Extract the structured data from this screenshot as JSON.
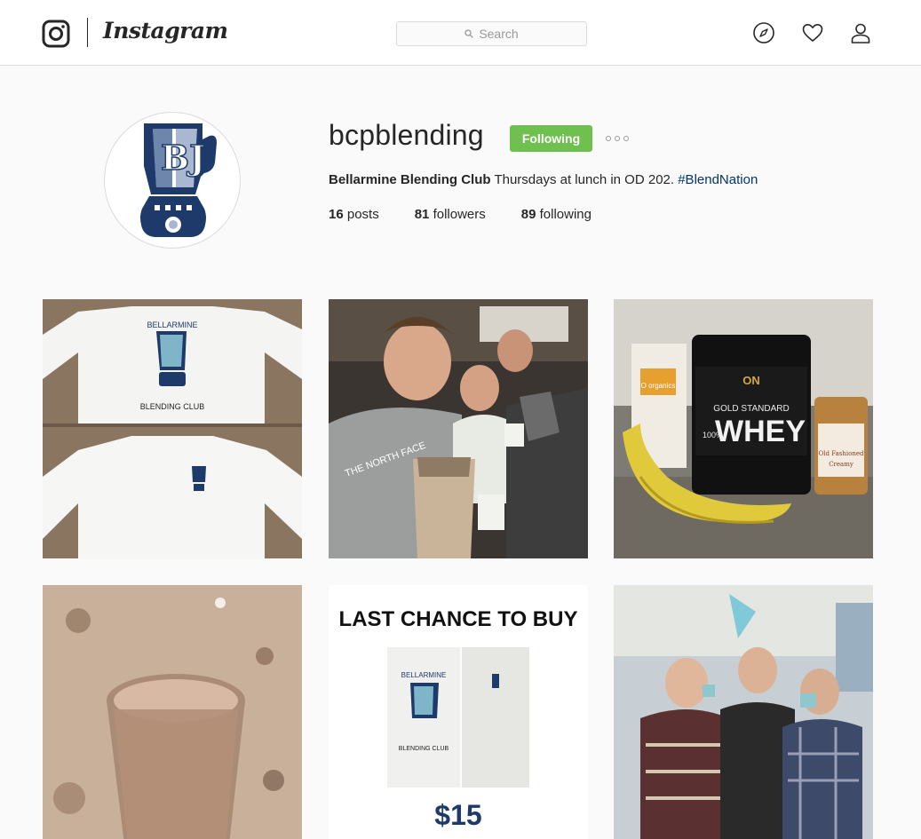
{
  "nav": {
    "wordmark": "Instagram",
    "search_placeholder": "Search",
    "icons": [
      "instagram-glyph-icon",
      "search-icon",
      "compass-icon",
      "heart-icon",
      "person-icon"
    ]
  },
  "profile": {
    "username": "bcpblending",
    "follow_label": "Following",
    "full_name": "Bellarmine Blending Club",
    "bio_text": "Thursdays at lunch in OD 202.",
    "hashtag": "#BlendNation",
    "posts_count": "16",
    "posts_label": "posts",
    "followers_count": "81",
    "followers_label": "followers",
    "following_count": "89",
    "following_label": "following",
    "avatar_letters": "BJ"
  },
  "posts": [
    {
      "id": "post-1",
      "caption_lines": [
        "BELLARMINE",
        "BLENDING CLUB"
      ]
    },
    {
      "id": "post-2",
      "caption_lines": [
        "THE NORTH FACE"
      ]
    },
    {
      "id": "post-3",
      "caption_lines": [
        "ON",
        "GOLD STANDARD",
        "100%",
        "WHEY",
        "O organics",
        "Old Fashioned",
        "Creamy"
      ]
    },
    {
      "id": "post-4",
      "caption_lines": []
    },
    {
      "id": "post-5",
      "caption_lines": [
        "LAST CHANCE TO BUY",
        "BELLARMINE",
        "BLENDING CLUB",
        "$15"
      ]
    },
    {
      "id": "post-6",
      "caption_lines": []
    }
  ],
  "colors": {
    "follow_green": "#70c050",
    "hashtag_blue": "#003569",
    "navy": "#1d3a6b",
    "light_blue": "#a9b8d0"
  }
}
